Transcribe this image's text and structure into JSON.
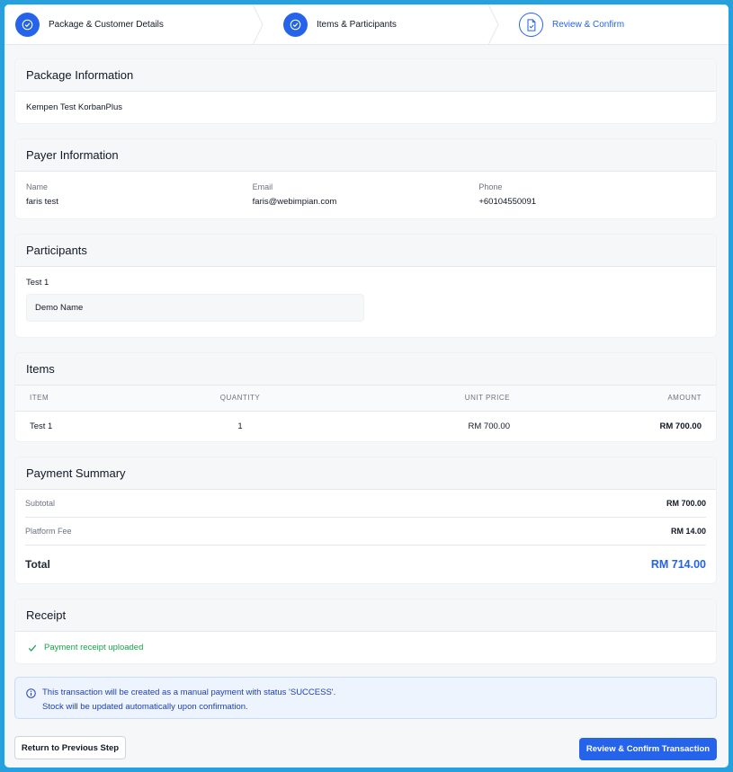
{
  "stepper": {
    "steps": [
      {
        "label": "Package & Customer Details",
        "state": "done",
        "icon": "check-icon"
      },
      {
        "label": "Items & Participants",
        "state": "done",
        "icon": "check-icon"
      },
      {
        "label": "Review & Confirm",
        "state": "current",
        "icon": "document-check-icon"
      }
    ]
  },
  "package": {
    "title": "Package Information",
    "name": "Kempen Test KorbanPlus"
  },
  "payer": {
    "title": "Payer Information",
    "name_label": "Name",
    "name": "faris test",
    "email_label": "Email",
    "email": "faris@webimpian.com",
    "phone_label": "Phone",
    "phone": "+60104550091"
  },
  "participants": {
    "title": "Participants",
    "group": "Test 1",
    "names": [
      "Demo Name"
    ]
  },
  "items": {
    "title": "Items",
    "columns": [
      "ITEM",
      "QUANTITY",
      "UNIT PRICE",
      "AMOUNT"
    ],
    "rows": [
      {
        "item": "Test 1",
        "quantity": "1",
        "unit_price": "RM 700.00",
        "amount": "RM 700.00"
      }
    ]
  },
  "summary": {
    "title": "Payment Summary",
    "subtotal_label": "Subtotal",
    "subtotal": "RM 700.00",
    "fee_label": "Platform Fee",
    "fee": "RM 14.00",
    "total_label": "Total",
    "total": "RM 714.00"
  },
  "receipt": {
    "title": "Receipt",
    "status": "Payment receipt uploaded"
  },
  "notice": {
    "line1": "This transaction will be created as a manual payment with status 'SUCCESS'.",
    "line2": "Stock will be updated automatically upon confirmation."
  },
  "actions": {
    "prev_label": "Return to Previous Step",
    "confirm_label": "Review & Confirm Transaction"
  },
  "colors": {
    "primary": "#2563eb",
    "success": "#16a34a",
    "frame_border": "#1ea2e6"
  }
}
